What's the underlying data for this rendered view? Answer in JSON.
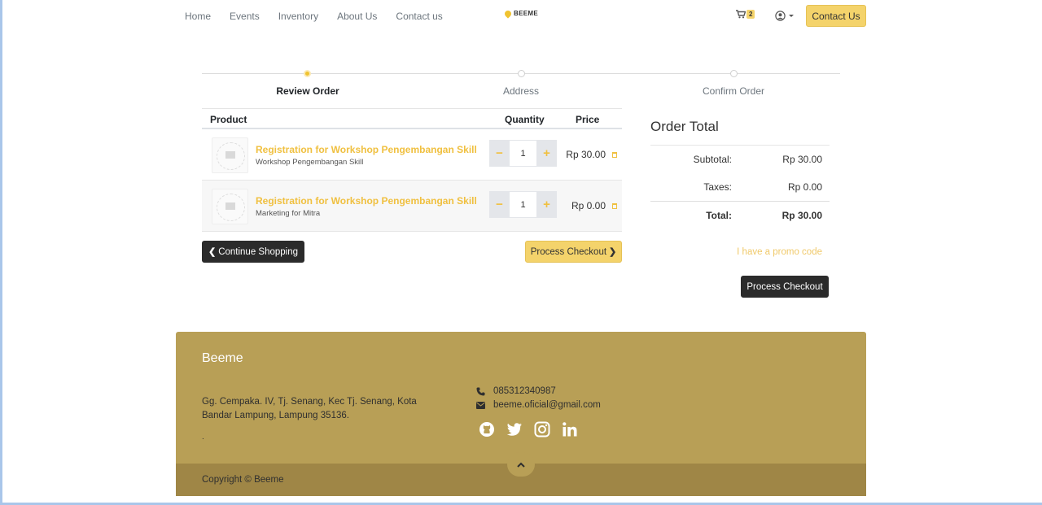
{
  "nav": {
    "links": [
      "Home",
      "Events",
      "Inventory",
      "About Us",
      "Contact us"
    ],
    "logo_text": "BEEME",
    "cart_count": "2",
    "contact_button": "Contact Us"
  },
  "stepper": {
    "steps": [
      "Review Order",
      "Address",
      "Confirm Order"
    ],
    "active_step": "Review Order"
  },
  "cart": {
    "headers": {
      "product": "Product",
      "quantity": "Quantity",
      "price": "Price"
    },
    "items": [
      {
        "name": "Registration for Workshop Pengembangan Skill",
        "subtitle": "Workshop Pengembangan Skill",
        "quantity": "1",
        "price": "Rp 30.00"
      },
      {
        "name": "Registration for Workshop Pengembangan Skill",
        "subtitle": "Marketing for Mitra",
        "quantity": "1",
        "price": "Rp 0.00"
      }
    ],
    "minus": "−",
    "plus": "+",
    "continue_button": "Continue Shopping",
    "checkout_button": "Process Checkout"
  },
  "order_total": {
    "title": "Order Total",
    "rows": [
      {
        "label": "Subtotal:",
        "value": "Rp 30.00"
      },
      {
        "label": "Taxes:",
        "value": "Rp 0.00"
      },
      {
        "label": "Total:",
        "value": "Rp 30.00"
      }
    ],
    "promo_link": "I have a promo code",
    "checkout_button": "Process Checkout"
  },
  "footer": {
    "brand": "Beeme",
    "address": "Gg. Cempaka. IV, Tj. Senang, Kec Tj. Senang, Kota Bandar Lampung, Lampung 35136.",
    "dot": ".",
    "phone": "085312340987",
    "email": "beeme.oficial@gmail.com",
    "social_icons": [
      "github-icon",
      "twitter-icon",
      "instagram-icon",
      "linkedin-icon"
    ],
    "copyright": "Copyright © Beeme"
  },
  "colors": {
    "accent": "#f4d36b",
    "accent_text": "#f0c040",
    "footer_bg": "#b89f56",
    "footer_bottom_bg": "#9f8646",
    "dark_button": "#2b2b2b"
  }
}
